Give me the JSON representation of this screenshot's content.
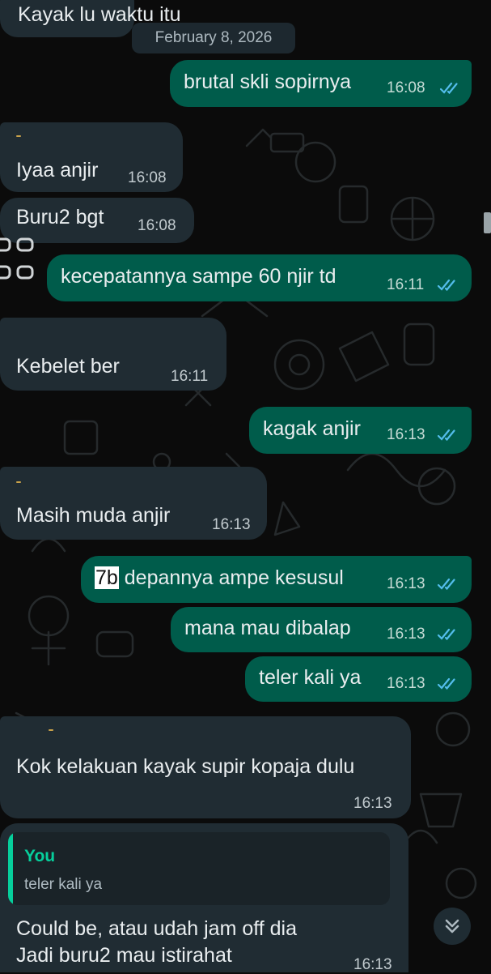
{
  "top_clip": {
    "text": "Kayak lu waktu itu"
  },
  "date_separator": "February 8, 2026",
  "messages": [
    {
      "direction": "outgoing",
      "text": "brutal skli sopirnya",
      "time": "16:08",
      "status": "read"
    },
    {
      "direction": "incoming",
      "text": "Iyaa anjir",
      "time": "16:08"
    },
    {
      "direction": "incoming",
      "text": "Buru2 bgt",
      "time": "16:08"
    },
    {
      "direction": "outgoing",
      "text": "kecepatannya sampe 60 njir td",
      "time": "16:11",
      "status": "read"
    },
    {
      "direction": "incoming",
      "text": "Kebelet ber",
      "time": "16:11"
    },
    {
      "direction": "outgoing",
      "text": "kagak anjir",
      "time": "16:13",
      "status": "read"
    },
    {
      "direction": "incoming",
      "text": "Masih muda anjir",
      "time": "16:13"
    },
    {
      "direction": "outgoing",
      "highlight": "7b",
      "text": " depannya ampe kesusul",
      "time": "16:13",
      "status": "read"
    },
    {
      "direction": "outgoing",
      "text": "mana mau dibalap",
      "time": "16:13",
      "status": "read"
    },
    {
      "direction": "outgoing",
      "text": "teler kali ya",
      "time": "16:13",
      "status": "read"
    },
    {
      "direction": "incoming",
      "text": "Kok kelakuan kayak supir kopaja dulu",
      "time": "16:13"
    },
    {
      "direction": "incoming",
      "quote": {
        "author": "You",
        "text": "teler kali ya"
      },
      "lines": [
        "Could be, atau udah jam off dia",
        "Jadi buru2 mau istirahat"
      ],
      "time": "16:13"
    }
  ],
  "colors": {
    "incoming_bubble": "#202c33",
    "outgoing_bubble": "#005c4b",
    "read_ticks": "#53bdeb",
    "quote_accent": "#06cf9c",
    "background": "#0b0b0b"
  },
  "icons": {
    "status": "double-check-icon",
    "scroll_down": "chevron-double-down-icon",
    "reaction": "emoji-reaction-icon"
  }
}
